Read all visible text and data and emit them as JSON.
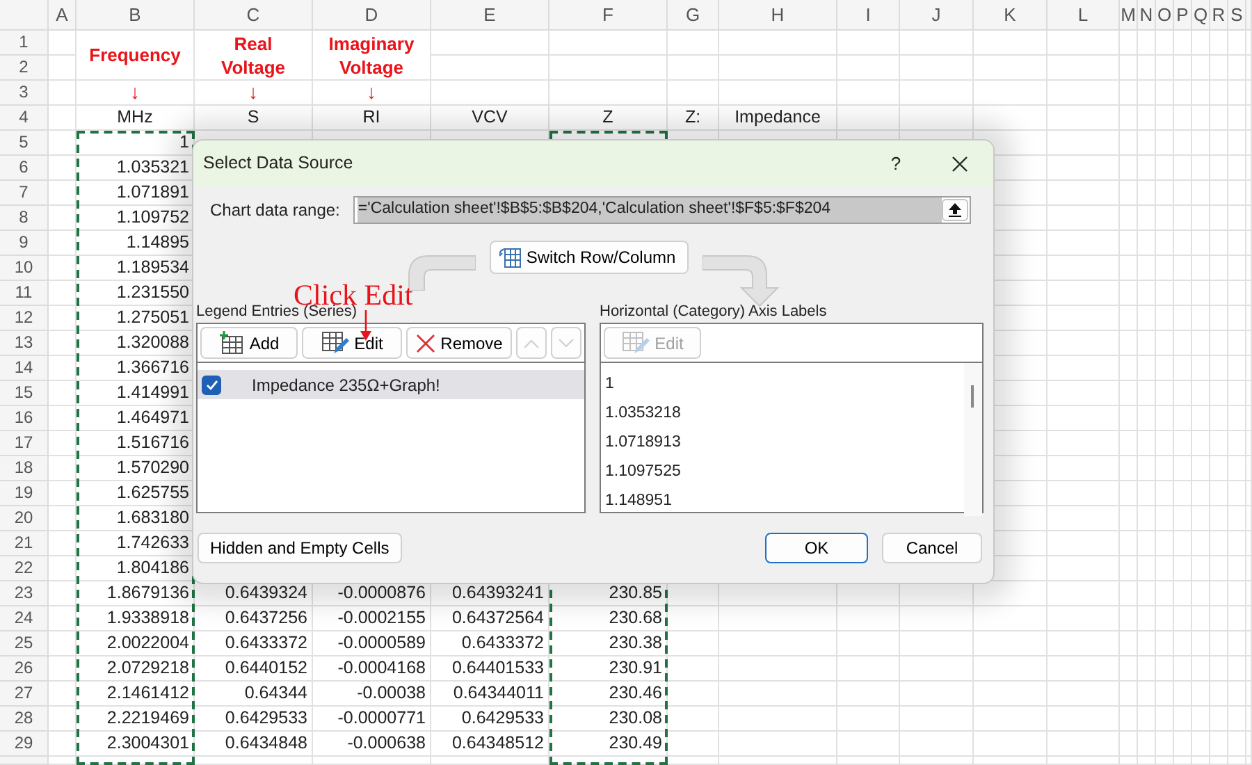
{
  "sheet": {
    "column_headers": [
      {
        "label": "A",
        "copied": false
      },
      {
        "label": "B",
        "copied": true
      },
      {
        "label": "C",
        "copied": false
      },
      {
        "label": "D",
        "copied": false
      },
      {
        "label": "E",
        "copied": false
      },
      {
        "label": "F",
        "copied": true
      },
      {
        "label": "G",
        "copied": false
      },
      {
        "label": "H",
        "copied": false
      },
      {
        "label": "I",
        "copied": false
      },
      {
        "label": "J",
        "copied": false
      },
      {
        "label": "K",
        "copied": false
      },
      {
        "label": "L",
        "copied": false
      },
      {
        "label": "M",
        "copied": false
      },
      {
        "label": "N",
        "copied": false
      },
      {
        "label": "O",
        "copied": false
      },
      {
        "label": "P",
        "copied": false
      },
      {
        "label": "Q",
        "copied": false
      },
      {
        "label": "R",
        "copied": false
      },
      {
        "label": "S",
        "copied": false
      }
    ],
    "rows": [
      {
        "number": "1",
        "kind": "note",
        "cells": {
          "b": "Frequency",
          "c": "Real Voltage",
          "d": "Imaginary Voltage"
        }
      },
      {
        "number": "2",
        "kind": "blank"
      },
      {
        "number": "3",
        "kind": "arrow",
        "cells": {
          "b": "↓",
          "c": "↓",
          "d": "↓"
        }
      },
      {
        "number": "4",
        "kind": "header",
        "cells": {
          "b": "MHz",
          "c": "S",
          "d": "RI",
          "e": "VCV",
          "f": "Z",
          "g": "Z:",
          "h": "Impedance"
        }
      },
      {
        "number": "5",
        "kind": "data",
        "cells": {
          "b": "1"
        }
      },
      {
        "number": "6",
        "kind": "data",
        "cells": {
          "b": "1.035321"
        }
      },
      {
        "number": "7",
        "kind": "data",
        "cells": {
          "b": "1.071891"
        }
      },
      {
        "number": "8",
        "kind": "data",
        "cells": {
          "b": "1.109752"
        }
      },
      {
        "number": "9",
        "kind": "data",
        "cells": {
          "b": "1.14895"
        }
      },
      {
        "number": "10",
        "kind": "data",
        "cells": {
          "b": "1.189534"
        }
      },
      {
        "number": "11",
        "kind": "data",
        "cells": {
          "b": "1.231550"
        }
      },
      {
        "number": "12",
        "kind": "data",
        "cells": {
          "b": "1.275051"
        }
      },
      {
        "number": "13",
        "kind": "data",
        "cells": {
          "b": "1.320088"
        }
      },
      {
        "number": "14",
        "kind": "data",
        "cells": {
          "b": "1.366716"
        }
      },
      {
        "number": "15",
        "kind": "data",
        "cells": {
          "b": "1.414991"
        }
      },
      {
        "number": "16",
        "kind": "data",
        "cells": {
          "b": "1.464971"
        }
      },
      {
        "number": "17",
        "kind": "data",
        "cells": {
          "b": "1.516716"
        }
      },
      {
        "number": "18",
        "kind": "data",
        "cells": {
          "b": "1.570290"
        }
      },
      {
        "number": "19",
        "kind": "data",
        "cells": {
          "b": "1.625755"
        }
      },
      {
        "number": "20",
        "kind": "data",
        "cells": {
          "b": "1.683180"
        }
      },
      {
        "number": "21",
        "kind": "data",
        "cells": {
          "b": "1.742633"
        }
      },
      {
        "number": "22",
        "kind": "data",
        "cells": {
          "b": "1.804186"
        }
      },
      {
        "number": "23",
        "kind": "data",
        "cells": {
          "b": "1.8679136",
          "c": "0.6439324",
          "d": "-0.0000876",
          "e": "0.64393241",
          "f": "230.85"
        }
      },
      {
        "number": "24",
        "kind": "data",
        "cells": {
          "b": "1.9338918",
          "c": "0.6437256",
          "d": "-0.0002155",
          "e": "0.64372564",
          "f": "230.68"
        }
      },
      {
        "number": "25",
        "kind": "data",
        "cells": {
          "b": "2.0022004",
          "c": "0.6433372",
          "d": "-0.0000589",
          "e": "0.6433372",
          "f": "230.38"
        }
      },
      {
        "number": "26",
        "kind": "data",
        "cells": {
          "b": "2.0729218",
          "c": "0.6440152",
          "d": "-0.0004168",
          "e": "0.64401533",
          "f": "230.91"
        }
      },
      {
        "number": "27",
        "kind": "data",
        "cells": {
          "b": "2.1461412",
          "c": "0.64344",
          "d": "-0.00038",
          "e": "0.64344011",
          "f": "230.46"
        }
      },
      {
        "number": "28",
        "kind": "data",
        "cells": {
          "b": "2.2219469",
          "c": "0.6429533",
          "d": "-0.0000771",
          "e": "0.6429533",
          "f": "230.08"
        }
      },
      {
        "number": "29",
        "kind": "data",
        "cells": {
          "b": "2.3004301",
          "c": "0.6434848",
          "d": "-0.000638",
          "e": "0.64348512",
          "f": "230.49"
        }
      }
    ]
  },
  "dialog": {
    "title": "Select Data Source",
    "help": "?",
    "range_label": "Chart data range:",
    "range_value": "='Calculation sheet'!$B$5:$B$204,'Calculation sheet'!$F$5:$F$204",
    "range_selected": true,
    "switch_button": "Switch Row/Column",
    "callout": "Click Edit",
    "legend": {
      "label": "Legend Entries (Series)",
      "buttons": [
        {
          "kind": "add",
          "label": "Add",
          "disabled": false
        },
        {
          "kind": "edit",
          "label": "Edit",
          "disabled": false
        },
        {
          "kind": "remove",
          "label": "Remove",
          "disabled": false
        },
        {
          "kind": "up",
          "disabled": true
        },
        {
          "kind": "down",
          "disabled": true
        }
      ],
      "items": [
        {
          "label": "Impedance 235Ω+Graph!",
          "checked": true,
          "selected": true
        }
      ]
    },
    "axis": {
      "label": "Horizontal (Category) Axis Labels",
      "edit_button": {
        "label": "Edit",
        "disabled": true
      },
      "items": [
        "1",
        "1.0353218",
        "1.0718913",
        "1.1097525",
        "1.148951"
      ]
    },
    "hidden_cells_button": "Hidden and Empty Cells",
    "ok_button": {
      "label": "OK",
      "default": true
    },
    "cancel_button": "Cancel"
  }
}
